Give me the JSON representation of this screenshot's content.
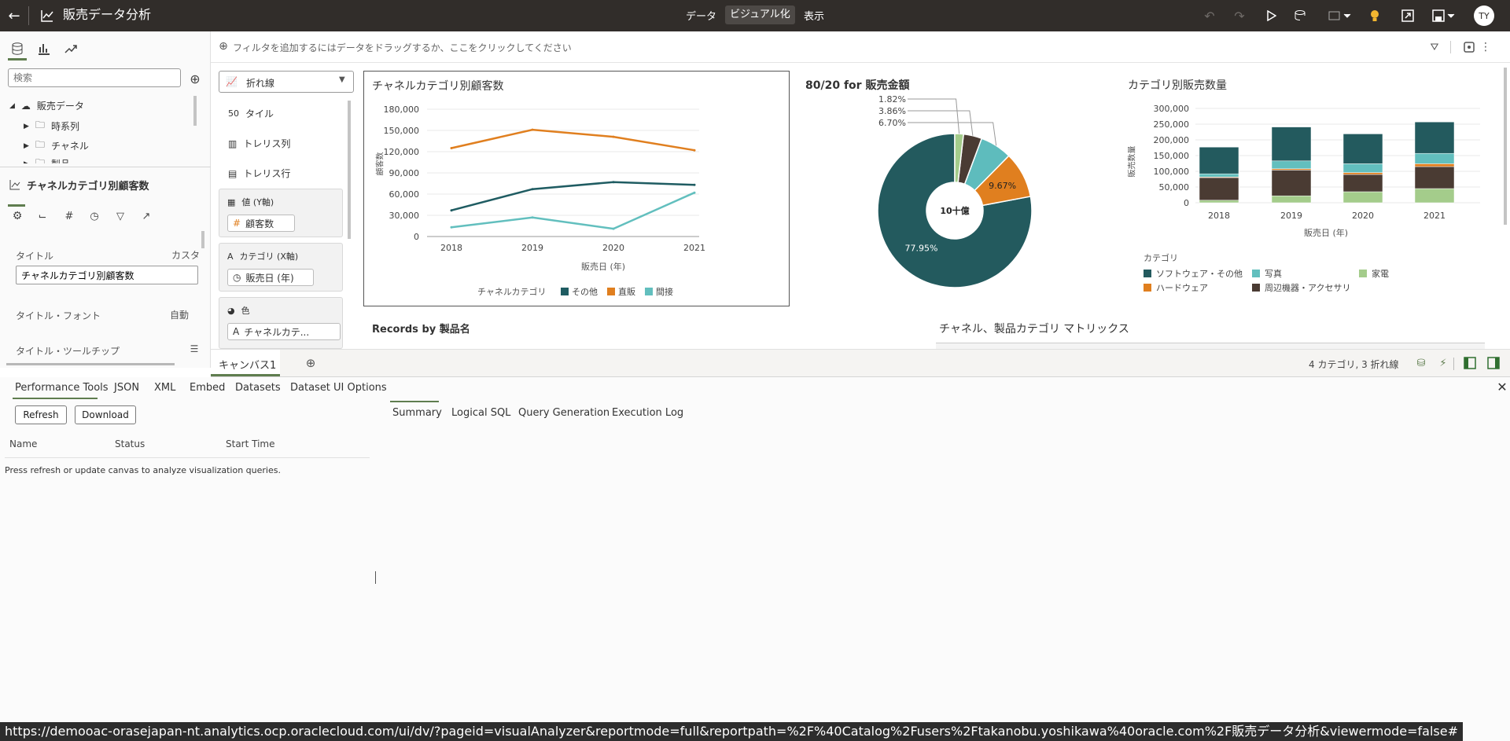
{
  "app": {
    "title": "販売データ分析",
    "nav": {
      "data": "データ",
      "visualize": "ビジュアル化",
      "present": "表示"
    },
    "avatar": "TY"
  },
  "filterbar": {
    "placeholder": "フィルタを追加するにはデータをドラッグするか、ここをクリックしてください"
  },
  "left": {
    "search_placeholder": "検索",
    "tree": [
      {
        "label": "販売データ",
        "expanded": true
      },
      {
        "label": "時系列"
      },
      {
        "label": "チャネル"
      },
      {
        "label": "製品"
      }
    ],
    "viz_title": "チャネルカテゴリ別顧客数",
    "props": {
      "title_label": "タイトル",
      "title_value_label": "カスタ",
      "title_input": "チャネルカテゴリ別顧客数",
      "font_label": "タイトル・フォント",
      "font_value": "自動",
      "tooltip_label": "タイトル・ツールチップ"
    }
  },
  "grammar": {
    "chart_type": "折れ線",
    "rows": [
      "タイル",
      "トレリス列",
      "トレリス行"
    ],
    "values_label": "値 (Y軸)",
    "values_pill": "顧客数",
    "category_label": "カテゴリ (X軸)",
    "category_pill": "販売日 (年)",
    "color_label": "色",
    "color_pill": "チャネルカテ..."
  },
  "charts": {
    "line": {
      "title": "チャネルカテゴリ別顧客数",
      "xlabel": "販売日 (年)",
      "ylabel": "顧客数",
      "legend_title": "チャネルカテゴリ"
    },
    "pie": {
      "title": "80/20 for 販売金額",
      "center": "10十億",
      "labels": [
        "77.95%",
        "9.67%",
        "6.70%",
        "3.86%",
        "1.82%"
      ]
    },
    "bar": {
      "title": "カテゴリ別販売数量",
      "xlabel": "販売日 (年)",
      "ylabel": "販売数量",
      "legend_title": "カテゴリ"
    },
    "records_title": "Records by 製品名",
    "matrix_title": "チャネル、製品カテゴリ マトリックス"
  },
  "chart_data": [
    {
      "type": "line",
      "title": "チャネルカテゴリ別顧客数",
      "categories": [
        "2018",
        "2019",
        "2020",
        "2021"
      ],
      "ylim": [
        0,
        180000
      ],
      "yticks": [
        "180,000",
        "150,000",
        "120,000",
        "90,000",
        "60,000",
        "30,000",
        "0"
      ],
      "series": [
        {
          "name": "その他",
          "color": "#1f5c62",
          "values": [
            37000,
            67000,
            77000,
            73000
          ]
        },
        {
          "name": "直販",
          "color": "#e07f1f",
          "values": [
            125000,
            151000,
            141000,
            122000
          ]
        },
        {
          "name": "間接",
          "color": "#62bfbe",
          "values": [
            13000,
            27000,
            11000,
            62000
          ]
        }
      ]
    },
    {
      "type": "pie",
      "title": "80/20 for 販売金額",
      "slices": [
        {
          "value": 77.95,
          "label": "77.95%",
          "color": "#235a5e"
        },
        {
          "value": 9.67,
          "label": "9.67%",
          "color": "#e07f1f"
        },
        {
          "value": 6.7,
          "label": "6.70%",
          "color": "#5ebcbd"
        },
        {
          "value": 3.86,
          "label": "3.86%",
          "color": "#4a3b33"
        },
        {
          "value": 1.82,
          "label": "1.82%",
          "color": "#a4cc8b"
        }
      ]
    },
    {
      "type": "bar",
      "title": "カテゴリ別販売数量",
      "categories": [
        "2018",
        "2019",
        "2020",
        "2021"
      ],
      "ylim": [
        0,
        300000
      ],
      "yticks": [
        "300,000",
        "250,000",
        "200,000",
        "150,000",
        "100,000",
        "50,000",
        "0"
      ],
      "series": [
        {
          "name": "家電",
          "color": "#a4cc8b",
          "values": [
            8000,
            22000,
            35000,
            45000
          ]
        },
        {
          "name": "周辺機器・アクセサリ",
          "color": "#4a3b33",
          "values": [
            72000,
            82000,
            55000,
            70000
          ]
        },
        {
          "name": "ハードウェア",
          "color": "#e07f1f",
          "values": [
            2000,
            4000,
            6000,
            9000
          ]
        },
        {
          "name": "写真",
          "color": "#62bfbe",
          "values": [
            10000,
            25000,
            28000,
            33000
          ]
        },
        {
          "name": "ソフトウェア・その他",
          "color": "#235a5e",
          "values": [
            85000,
            108000,
            95000,
            100000
          ]
        }
      ]
    }
  ],
  "tabs": {
    "canvas1": "キャンバス1",
    "status": "4 カテゴリ, 3 折れ線"
  },
  "bottom": {
    "tabs": [
      "Performance Tools",
      "JSON",
      "XML",
      "Embed",
      "Datasets",
      "Dataset UI Options"
    ],
    "refresh": "Refresh",
    "download": "Download",
    "cols": [
      "Name",
      "Status",
      "Start Time"
    ],
    "message": "Press refresh or update canvas to analyze visualization queries.",
    "subtabs": [
      "Summary",
      "Logical SQL",
      "Query Generation",
      "Execution Log"
    ]
  },
  "url": "https://demooac-orasejapan-nt.analytics.ocp.oraclecloud.com/ui/dv/?pageid=visualAnalyzer&reportmode=full&reportpath=%2F%40Catalog%2Fusers%2Ftakanobu.yoshikawa%40oracle.com%2F販売データ分析&viewermode=false#"
}
